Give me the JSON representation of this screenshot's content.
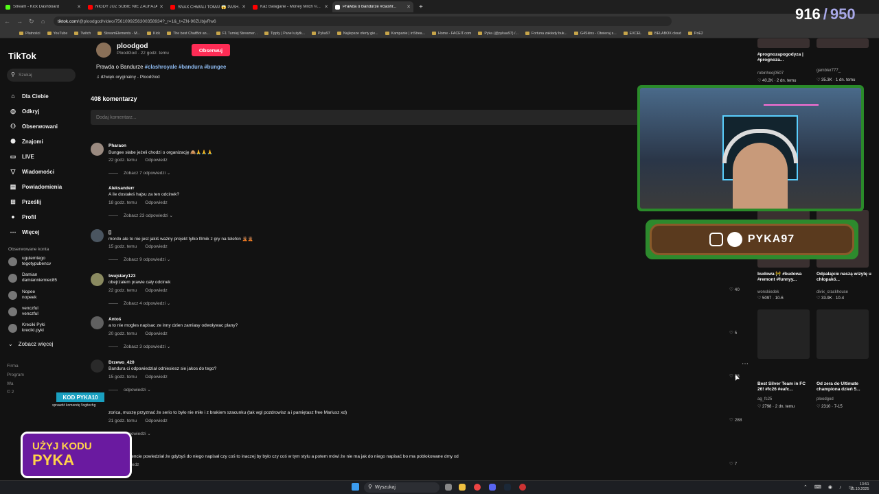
{
  "tabs": [
    {
      "label": "Stream - Kick Dashboard",
      "color": "#53fc18"
    },
    {
      "label": "NIGDY JUŻ SOBIE NIE ZAUFAJĄ",
      "color": "#ff0000"
    },
    {
      "label": "SNAX CHWALI TOMA! 😱 PASH...",
      "color": "#ff0000"
    },
    {
      "label": "Kaz Balagane - Money Mitch ©...",
      "color": "#ff0000"
    },
    {
      "label": "Prawda o Bandurze #clashr...",
      "color": "#ffffff"
    }
  ],
  "url": {
    "host": "tiktok.com",
    "path": "/@ploodgod/video/7561099256300358934?_r=1&_t=ZN-90ZUbjvRw6"
  },
  "bookmarks": [
    "Płatności",
    "YouTube",
    "Twitch",
    "StreamElements - M...",
    "Kick",
    "The best ChatBot an...",
    "F1 Turniej Streamer...",
    "Tipply | Panel użytk...",
    "Pyka97",
    "Najlepsze oferty gie...",
    "Kampanie | inStrea...",
    "Home - FACEIT.com",
    "Pyka (@pykaa97) /...",
    "Fortuna zakłady buk...",
    "G4Skins - Otwieraj s...",
    "EXCEL",
    "BELABOX cloud",
    "PoE2"
  ],
  "sidebar": {
    "logo": "TikTok",
    "search_placeholder": "Szukaj",
    "items": [
      {
        "label": "Dla Ciebie",
        "icon": "⌂"
      },
      {
        "label": "Odkryj",
        "icon": "◎"
      },
      {
        "label": "Obserwowani",
        "icon": "⚇"
      },
      {
        "label": "Znajomi",
        "icon": "⚉"
      },
      {
        "label": "LIVE",
        "icon": "▭"
      },
      {
        "label": "Wiadomości",
        "icon": "▽"
      },
      {
        "label": "Powiadomienia",
        "icon": "▤"
      },
      {
        "label": "Prześlij",
        "icon": "⊞"
      },
      {
        "label": "Profil",
        "icon": "●"
      },
      {
        "label": "Więcej",
        "icon": "⋯"
      }
    ],
    "following_header": "Obserwowane konta",
    "accounts": [
      {
        "line1": "ugulemtego",
        "line2": "tegotypubencv"
      },
      {
        "line1": "Damian",
        "line2": "damianniemiec85"
      },
      {
        "line1": "Nopee",
        "line2": "nopeek"
      },
      {
        "line1": "venczful",
        "line2": "venczful"
      },
      {
        "line1": "Kreciki Pyki",
        "line2": "kreciki.pyki"
      }
    ],
    "see_more": "Zobacz więcej",
    "footer": [
      "Firma",
      "Program",
      "Wa",
      "© 2"
    ]
  },
  "post": {
    "username": "ploodgod",
    "meta": "PloodGod · 22 godz. temu",
    "follow_label": "Obserwuj",
    "desc_text": "Prawda o Bandurze ",
    "tags": "#clashroyale #bandura #bungee",
    "sound": "♫ dźwięk oryginalny - PloodGod",
    "comment_count": "408 komentarzy",
    "add_comment_placeholder": "Dodaj komentarz..."
  },
  "comments": [
    {
      "name": "Pharaon",
      "text": "Bungee słabe jeżeli chodzi o organizację 🙈🙏🙏🙏",
      "time": "22 godz. temu",
      "reply": "Odpowiedz",
      "more": "Zobacz 7 odpowiedzi ⌄",
      "likes": ""
    },
    {
      "name": "Aleksanderr",
      "text": "A ile dostałeś hajsu za ten odcinek?",
      "time": "18 godz. temu",
      "reply": "Odpowiedz",
      "more": "Zobacz 23 odpowiedzi ⌄",
      "likes": ""
    },
    {
      "name": "[]",
      "text": "mordo ale to nie jest jakiś ważny projekt tylko filmik z gry na telefon 🤦🏾🤦🏾",
      "time": "15 godz. temu",
      "reply": "Odpowiedz",
      "more": "Zobacz 9 odpowiedzi ⌄",
      "likes": ""
    },
    {
      "name": "twujstary123",
      "text": "obejrzałem prawie cały odcinek",
      "time": "22 godz. temu",
      "reply": "Odpowiedz",
      "more": "Zobacz 4 odpowiedzi ⌄",
      "likes": "♡ 40"
    },
    {
      "name": "Antoś",
      "text": "a to nie mogles napisac ze inny dzien zamiasy odwoływac plany?",
      "time": "20 godz. temu",
      "reply": "Odpowiedz",
      "more": "Zobacz 3 odpowiedzi ⌄",
      "likes": "♡ 5"
    },
    {
      "name": "Drzewo_420",
      "text": "Bandura ci odpowiedział odniesiesz sie jakos do tego?",
      "time": "15 godz. temu",
      "reply": "Odpowiedz",
      "more": "odpowiedzi ⌄",
      "likes": "♡ 28"
    },
    {
      "name": "",
      "text": "zorica, muszę przyznać że serio to było nie miłe i z brakiem szacunku (tak wgl pozdrowisz a i pamiętasz free Mariusz xd)",
      "time": "21 godz. temu",
      "reply": "Odpowiedz",
      "more": "odpowiedzi ⌄",
      "likes": "♡ 288"
    },
    {
      "name": "nn",
      "text": "wnym momencie powiedział że gdybyś do niego napisał czy coś to inaczej by było czy coś w tym stylu a potem mówi że nie ma jak do niego napisać bo ma poblokowane dmy xd",
      "time": "",
      "reply": "Odpowiedz",
      "more": "",
      "likes": "♡ 7"
    }
  ],
  "related": [
    {
      "title": "#prognozapogodyza | #prognoza...",
      "author": "robinhooj0507",
      "stats": "♡ 40.2K · 2 dn. temu"
    },
    {
      "title": "",
      "author": "gambler777_",
      "stats": "♡ 35.3K · 1 dn. temu"
    },
    {
      "title": "budowa 🚧 #budowa #remont #funnyy...",
      "author": "wonskiedek",
      "stats": "♡ 5097 · 10-6"
    },
    {
      "title": "Odpalajcie naszą wizytę u chłopakó...",
      "author": "divix_crackhouse",
      "stats": "♡ 33.9K · 10-4"
    },
    {
      "title": "Best Silver Team in FC 26! #fc26 #eafc...",
      "author": "ag_fc25",
      "stats": "♡ 2798 · 2 dn. temu"
    },
    {
      "title": "Od zera do Ultimate championa dzień 5...",
      "author": "ploodgod",
      "stats": "♡ 2310 · 7-15"
    }
  ],
  "overlay": {
    "score_a": "916",
    "score_b": "950",
    "banner": "PYKA97",
    "promo": "KOD PYKA10",
    "promo_sub": "sprawdź komendę !logitechg",
    "pyka_a": "UŻYJ KODU",
    "pyka_b": "PYKA"
  },
  "taskbar": {
    "search": "Wyszukaj",
    "time": "13:51",
    "date": "15.10.2025"
  }
}
